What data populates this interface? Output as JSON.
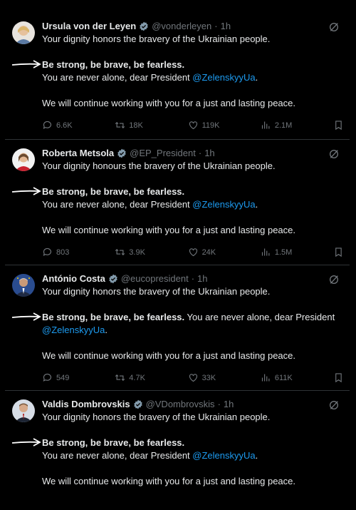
{
  "tweets": [
    {
      "name": "Ursula von der Leyen",
      "handle": "@vonderleyen",
      "time": "1h",
      "line1": "Your dignity honors the bravery of the Ukrainian people.",
      "bold": "Be strong, be brave, be fearless.",
      "line3_pre": "You are never alone, dear President ",
      "mention": "@ZelenskyyUa",
      "line3_post": ".",
      "line4": "We will continue working with you for a just and lasting peace.",
      "replies": "6.6K",
      "reposts": "18K",
      "likes": "119K",
      "views": "2.1M"
    },
    {
      "name": "Roberta Metsola",
      "handle": "@EP_President",
      "time": "1h",
      "line1": "Your dignity honours the bravery of the Ukrainian people.",
      "bold": "Be strong, be brave, be fearless.",
      "line3_pre": "You are never alone, dear President ",
      "mention": "@ZelenskyyUa",
      "line3_post": ".",
      "line4": "We will continue working with you for a just and lasting peace.",
      "replies": "803",
      "reposts": "3.9K",
      "likes": "24K",
      "views": "1.5M"
    },
    {
      "name": "António Costa",
      "handle": "@eucopresident",
      "time": "1h",
      "line1": "Your dignity honors the bravery of the Ukrainian people.",
      "bold": "Be strong, be brave, be fearless.",
      "line2_rest": " You are never alone, dear President",
      "mention": "@ZelenskyyUa",
      "line3_post": ".",
      "line4": "We will continue working with you for a just and lasting peace.",
      "replies": "549",
      "reposts": "4.7K",
      "likes": "33K",
      "views": "611K"
    },
    {
      "name": "Valdis Dombrovskis",
      "handle": "@VDombrovskis",
      "time": "1h",
      "line1": "Your dignity honors the bravery of the Ukrainian people.",
      "bold": "Be strong, be brave, be fearless.",
      "line3_pre": "You are never alone, dear President ",
      "mention": "@ZelenskyyUa",
      "line3_post": ".",
      "line4": "We will continue working with you for a just and lasting peace."
    }
  ],
  "separator": "·",
  "icons": {
    "verified": "verified-badge-icon",
    "grok": "grok-icon",
    "reply": "reply-icon",
    "repost": "repost-icon",
    "like": "heart-icon",
    "views": "views-icon",
    "bookmark": "bookmark-icon",
    "arrow": "hand-drawn-arrow-icon"
  },
  "colors": {
    "background": "#000000",
    "text": "#e7e9ea",
    "muted": "#71767b",
    "mention": "#1d9bf0",
    "verified": "#829aab"
  }
}
